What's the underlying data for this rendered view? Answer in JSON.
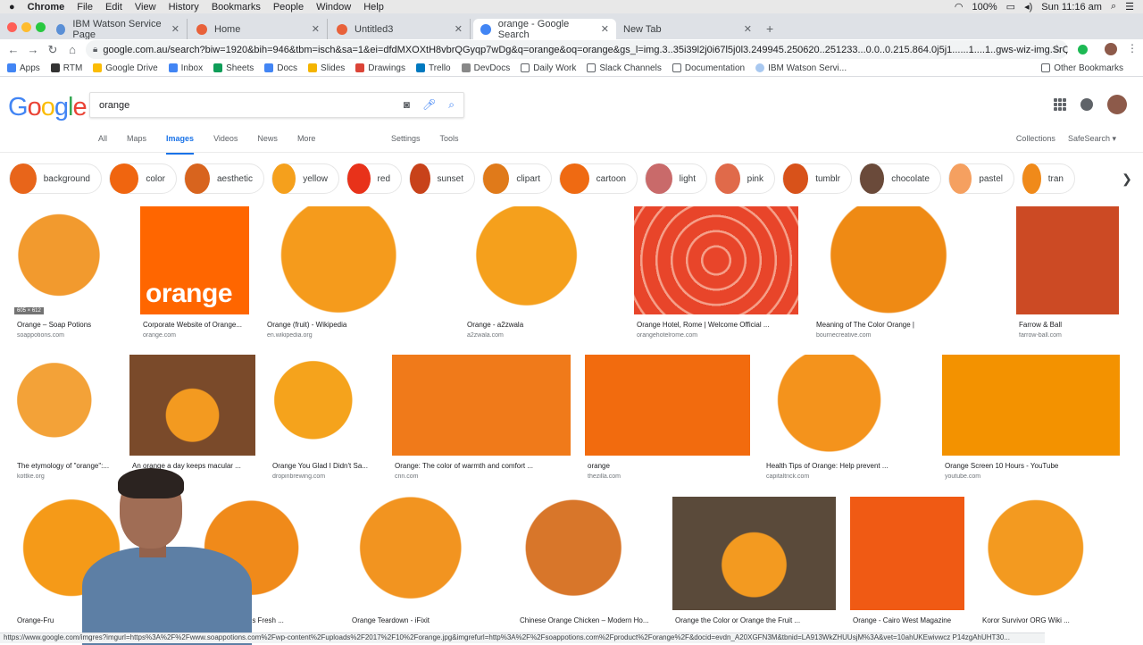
{
  "menubar": {
    "app": "Chrome",
    "items": [
      "File",
      "Edit",
      "View",
      "History",
      "Bookmarks",
      "People",
      "Window",
      "Help"
    ],
    "battery": "100%",
    "clock": "Sun 11:16 am"
  },
  "tabs": [
    {
      "label": "IBM Watson Service Page",
      "color": "#5a8fd6"
    },
    {
      "label": "Home",
      "color": "#e8613a"
    },
    {
      "label": "Untitled3",
      "color": "#e8613a"
    },
    {
      "label": "orange - Google Search",
      "color": "#4285f4"
    },
    {
      "label": "New Tab",
      "color": ""
    }
  ],
  "omnibox": {
    "url": "google.com.au/search?biw=1920&bih=946&tbm=isch&sa=1&ei=dfdMXOXtH8vbrQGyqp7wDg&q=orange&oq=orange&gs_l=img.3..35i39l2j0i67l5j0l3.249945.250620..251233...0.0..0.215.864.0j5j1......1....1..gws-wiz-img.SrQvZefEPDk"
  },
  "bookmarks": {
    "items": [
      "Apps",
      "RTM",
      "Google Drive",
      "Inbox",
      "Sheets",
      "Docs",
      "Slides",
      "Drawings",
      "Trello",
      "DevDocs",
      "Daily Work",
      "Slack Channels",
      "Documentation",
      "IBM Watson Servi..."
    ],
    "other": "Other Bookmarks"
  },
  "google": {
    "logo": [
      "G",
      "o",
      "o",
      "g",
      "l",
      "e"
    ],
    "logo_colors": [
      "#4285f4",
      "#ea4335",
      "#fbbc05",
      "#4285f4",
      "#34a853",
      "#ea4335"
    ],
    "query": "orange",
    "nav": [
      "All",
      "Maps",
      "Images",
      "Videos",
      "News",
      "More"
    ],
    "settings": "Settings",
    "tools": "Tools",
    "collections": "Collections",
    "safesearch": "SafeSearch ▾"
  },
  "chips": [
    {
      "label": "background",
      "color": "#e8651a"
    },
    {
      "label": "color",
      "color": "#f0650f"
    },
    {
      "label": "aesthetic",
      "color": "#d8641e"
    },
    {
      "label": "yellow",
      "color": "#f5a01c"
    },
    {
      "label": "red",
      "color": "#e8321a"
    },
    {
      "label": "sunset",
      "color": "#c8421a"
    },
    {
      "label": "clipart",
      "color": "#e07a1a"
    },
    {
      "label": "cartoon",
      "color": "#ef6a12"
    },
    {
      "label": "light",
      "color": "#c96a6a"
    },
    {
      "label": "pink",
      "color": "#e06a4a"
    },
    {
      "label": "tumblr",
      "color": "#d8521a"
    },
    {
      "label": "chocolate",
      "color": "#6a4a3a"
    },
    {
      "label": "pastel",
      "color": "#f5a060"
    },
    {
      "label": "tran",
      "color": "#f08a1a"
    }
  ],
  "results": [
    {
      "caption": "Orange – Soap Potions",
      "source": "soappotions.com",
      "dims": "605 × 612",
      "color": "#f29a2e"
    },
    {
      "caption": "Corporate Website of Orange...",
      "source": "orange.com",
      "word": "orange",
      "color": "#ff6600"
    },
    {
      "caption": "Orange (fruit) - Wikipedia",
      "source": "en.wikipedia.org",
      "color": "#f59b1c"
    },
    {
      "caption": "Orange - a2zwala",
      "source": "a2zwala.com",
      "color": "#f5a01c"
    },
    {
      "caption": "Orange Hotel, Rome | Welcome Official ...",
      "source": "orangehotelrome.com",
      "color": "#e8452a"
    },
    {
      "caption": "Meaning of The Color Orange |",
      "source": "bournecreative.com",
      "color": "#ef8a14"
    },
    {
      "caption": "Farrow & Ball",
      "source": "farrow-ball.com",
      "color": "#cc4a24"
    },
    {
      "caption": "The etymology of \"orange\":...",
      "source": "kottke.org",
      "color": "#f3a238"
    },
    {
      "caption": "An orange a day keeps macular ...",
      "source": "",
      "color": "#7a4a2a"
    },
    {
      "caption": "Orange You Glad I Didn't Sa...",
      "source": "dropinbrewing.com",
      "color": "#f5a31c"
    },
    {
      "caption": "Orange: The color of warmth and comfort ...",
      "source": "cnn.com",
      "color": "#f07a1a"
    },
    {
      "caption": "orange",
      "source": "thezilla.com",
      "color": "#f26b0e"
    },
    {
      "caption": "Health Tips of Orange: Help prevent ...",
      "source": "capitaltrick.com",
      "color": "#f4931c"
    },
    {
      "caption": "Orange Screen 10 Hours - YouTube",
      "source": "youtube.com",
      "color": "#f39200"
    },
    {
      "caption": "Orange-Fru",
      "source": "",
      "color": "#f59a18"
    },
    {
      "caption": "cia - Irv & Shelly's Fresh ...",
      "source": "",
      "color": "#f08a1a"
    },
    {
      "caption": "Orange Teardown - iFixit",
      "source": "",
      "color": "#f29420"
    },
    {
      "caption": "Chinese Orange Chicken – Modern Ho...",
      "source": "",
      "color": "#d8762a"
    },
    {
      "caption": "Orange the Color or Orange the Fruit ...",
      "source": "",
      "color": "#5a4a3a"
    },
    {
      "caption": "Orange - Cairo West Magazine",
      "source": "",
      "color": "#f05a14"
    },
    {
      "caption": "Koror Survivor ORG Wiki ...",
      "source": "",
      "color": "#f39a20"
    }
  ],
  "statusbar": "https://www.google.com/imgres?imgurl=https%3A%2F%2Fwww.soappotions.com%2Fwp-content%2Fuploads%2F2017%2F10%2Forange.jpg&imgrefurl=http%3A%2F%2Fsoappotions.com%2Fproduct%2Forange%2F&docid=evdn_A20XGFN3M&tbnid=LA913WkZHUUsjM%3A&vet=10ahUKEwivwcz P14zgAhUHT30..."
}
